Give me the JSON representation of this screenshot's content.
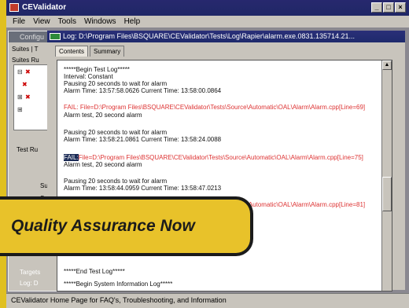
{
  "window": {
    "title": "CEValidator"
  },
  "menu": [
    "File",
    "View",
    "Tools",
    "Windows",
    "Help"
  ],
  "left_panel": {
    "title": "Configu",
    "tab": "Suites | T",
    "tree_header": "Suites Ru",
    "label_test": "Test Ru",
    "label_su1": "Su",
    "label_su2": "Su",
    "bottom1": "Targets",
    "bottom2": "Log: D"
  },
  "log_window": {
    "title": "Log: D:\\Program Files\\BSQUARE\\CEValidator\\Tests\\Log\\Rapier\\alarm.exe.0831.135714.21...",
    "tabs": [
      "Contents",
      "Summary"
    ],
    "lines": [
      {
        "text": "*****Begin Test Log*****",
        "type": "normal"
      },
      {
        "text": "Interval: Constant",
        "type": "normal"
      },
      {
        "text": "Pausing 20 seconds to wait for alarm",
        "type": "normal"
      },
      {
        "text": "Alarm Time: 13:57:58.0626  Current Time: 13:58:00.0864",
        "type": "normal"
      },
      {
        "text": "FAIL: File=D:\\Program Files\\BSQUARE\\CEValidator\\Tests\\Source\\Automatic\\OAL\\Alarm\\Alarm.cpp[Line=69]",
        "type": "fail"
      },
      {
        "text": "Alarm test, 20 second alarm",
        "type": "normal"
      },
      {
        "text": "Pausing 20 seconds to wait for alarm",
        "type": "normal"
      },
      {
        "text": "Alarm Time: 13:58:21.0861  Current Time: 13:58:24.0088",
        "type": "normal"
      },
      {
        "text": "File=D:\\Program Files\\BSQUARE\\CEValidator\\Tests\\Source\\Automatic\\OAL\\Alarm\\Alarm.cpp[Line=75]",
        "type": "fail",
        "hl": "FAIL:"
      },
      {
        "text": "Alarm test, 20 second alarm",
        "type": "normal"
      },
      {
        "text": "Pausing 20 seconds to wait for alarm",
        "type": "normal"
      },
      {
        "text": "Alarm Time: 13:58:44.0959  Current Time: 13:58:47.0213",
        "type": "normal"
      },
      {
        "text": "FAIL: File=D:\\Program Files\\BSQUARE\\CEValidator\\Tests\\Source\\Automatic\\OAL\\Alarm\\Alarm.cpp[Line=81]",
        "type": "fail"
      },
      {
        "text": "*****End Test Log*****",
        "type": "normal"
      },
      {
        "text": "*****Begin System Information Log*****",
        "type": "normal"
      }
    ]
  },
  "status_bar": "CEValidator Home Page for FAQ's, Troubleshooting, and Information",
  "banner": "Quality Assurance Now"
}
